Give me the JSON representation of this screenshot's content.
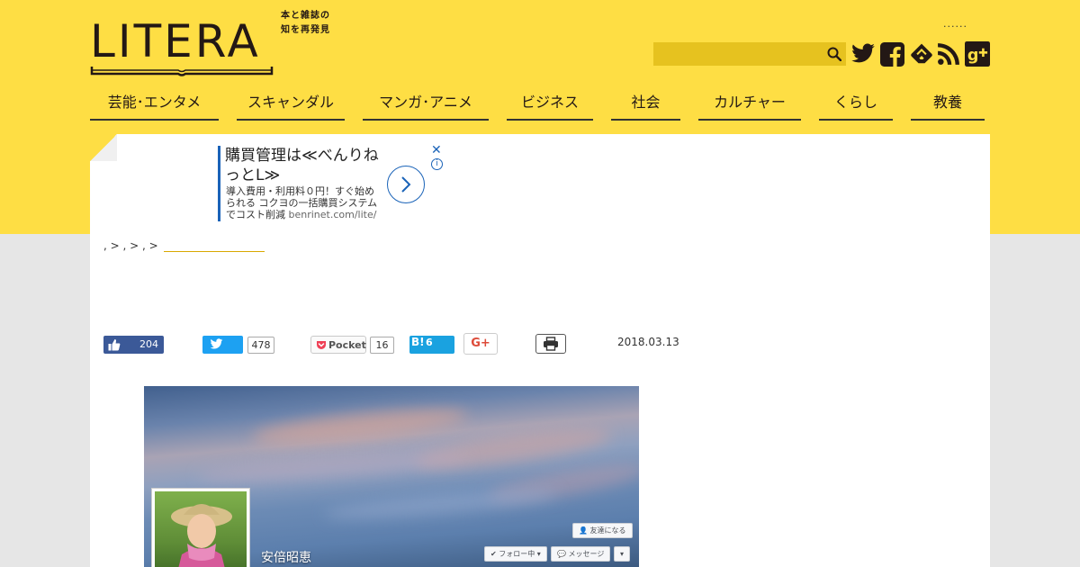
{
  "site": {
    "logo_text": "LITERA",
    "tagline_line1": "本と雑誌の",
    "tagline_line2": "知を再発見",
    "header_dots": "......"
  },
  "search": {
    "value": "",
    "placeholder": ""
  },
  "social_icons": [
    "twitter-icon",
    "facebook-icon",
    "feedly-icon",
    "rss-icon",
    "google-plus-icon"
  ],
  "nav": {
    "items": [
      {
        "label": "芸能･エンタメ"
      },
      {
        "label": "スキャンダル"
      },
      {
        "label": "マンガ･アニメ"
      },
      {
        "label": "ビジネス"
      },
      {
        "label": "社会"
      },
      {
        "label": "カルチャー"
      },
      {
        "label": "くらし"
      },
      {
        "label": "教養"
      }
    ]
  },
  "ad": {
    "headline": "購買管理は≪べんりねっとL≫",
    "body": "導入費用・利用料０円！すぐ始められる コクヨの一括購買システムでコスト削減",
    "domain": "benrinet.com/lite/",
    "close": "✕",
    "info": "i"
  },
  "breadcrumb": {
    "text": ", > , > , >"
  },
  "share": {
    "facebook_count": "204",
    "twitter_count": "478",
    "pocket_label": "Pocket",
    "pocket_count": "16",
    "hatena_label": "B!",
    "hatena_count": "6",
    "gplus_label": "G+"
  },
  "article": {
    "date": "2018.03.13"
  },
  "photo": {
    "profile_name": "安倍昭恵",
    "add_friend": "友達になる",
    "following": "フォロー中 ▾",
    "message": "メッセージ",
    "more": "▾"
  },
  "colors": {
    "brand_yellow": "#fede44",
    "facebook": "#3b5998",
    "twitter": "#1da1f2",
    "hatena": "#1aa2e0"
  }
}
